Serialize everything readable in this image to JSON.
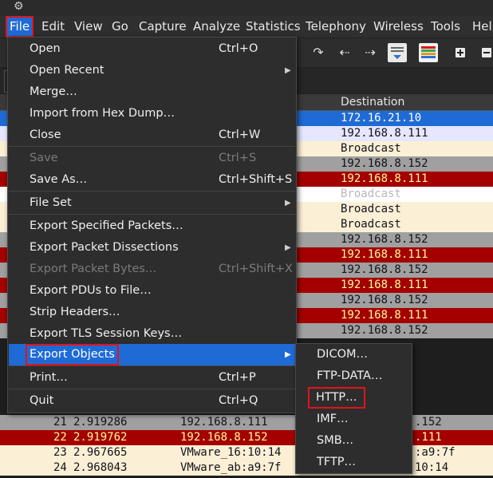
{
  "colors": {
    "selected": "#1f6bd6",
    "highlight_outline": "#e0141b",
    "row_red": "#a40000",
    "row_red_text": "#fffc9c",
    "row_grey": "#a0a0a0",
    "row_cream": "#fbf0d6",
    "row_white": "#ffffff",
    "row_lavender": "#e7e6ff"
  },
  "menubar": {
    "items": [
      {
        "label": "File",
        "key": "file"
      },
      {
        "label": "Edit",
        "key": "edit"
      },
      {
        "label": "View",
        "key": "view"
      },
      {
        "label": "Go",
        "key": "go"
      },
      {
        "label": "Capture",
        "key": "capture"
      },
      {
        "label": "Analyze",
        "key": "analyze"
      },
      {
        "label": "Statistics",
        "key": "statistics"
      },
      {
        "label": "Telephony",
        "key": "telephony"
      },
      {
        "label": "Wireless",
        "key": "wireless"
      },
      {
        "label": "Tools",
        "key": "tools"
      },
      {
        "label": "Help",
        "key": "help"
      }
    ]
  },
  "toolbar": {
    "icons": [
      "go-to-packet-icon",
      "go-back-icon",
      "go-forward-icon",
      "autoscroll-icon",
      "colorize-icon",
      "zoom-in-icon",
      "zoom-out-icon"
    ]
  },
  "packet_list": {
    "header": {
      "destination": "Destination"
    },
    "rows_upper": [
      {
        "dest": "172.16.21.10",
        "style": "selected"
      },
      {
        "dest": "192.168.8.111",
        "style": "lavender"
      },
      {
        "dest": "Broadcast",
        "style": "cream"
      },
      {
        "dest": "192.168.8.152",
        "style": "grey"
      },
      {
        "dest": "192.168.8.111",
        "style": "red"
      },
      {
        "dest": "Broadcast",
        "style": "white"
      },
      {
        "dest": "Broadcast",
        "style": "cream"
      },
      {
        "dest": "Broadcast",
        "style": "cream"
      },
      {
        "dest": "192.168.8.152",
        "style": "grey"
      },
      {
        "dest": "192.168.8.111",
        "style": "red"
      },
      {
        "dest": "192.168.8.152",
        "style": "grey"
      },
      {
        "dest": "192.168.8.111",
        "style": "red"
      },
      {
        "dest": "192.168.8.152",
        "style": "grey"
      },
      {
        "dest": "192.168.8.111",
        "style": "red"
      },
      {
        "dest": "192.168.8.152",
        "style": "grey"
      }
    ],
    "rows_lower": [
      {
        "no": "21",
        "time": "2.919286",
        "source": "192.168.8.111",
        "dest": ".152",
        "style": "grey"
      },
      {
        "no": "22",
        "time": "2.919762",
        "source": "192.168.8.152",
        "dest": ".111",
        "style": "red"
      },
      {
        "no": "23",
        "time": "2.967665",
        "source": "VMware_16:10:14",
        "dest": ":a9:7f",
        "style": "cream"
      },
      {
        "no": "24",
        "time": "2.968043",
        "source": "VMware_ab:a9:7f",
        "dest": "10:14",
        "style": "cream"
      }
    ]
  },
  "file_menu": {
    "items": [
      {
        "label": "Open",
        "shortcut": "Ctrl+O"
      },
      {
        "label": "Open Recent",
        "shortcut": "",
        "submenu": true
      },
      {
        "label": "Merge…",
        "shortcut": ""
      },
      {
        "label": "Import from Hex Dump…",
        "shortcut": ""
      },
      {
        "label": "Close",
        "shortcut": "Ctrl+W"
      },
      {
        "label": "Save",
        "shortcut": "Ctrl+S",
        "disabled": true
      },
      {
        "label": "Save As…",
        "shortcut": "Ctrl+Shift+S"
      },
      {
        "label": "File Set",
        "shortcut": "",
        "submenu": true
      },
      {
        "label": "Export Specified Packets…",
        "shortcut": ""
      },
      {
        "label": "Export Packet Dissections",
        "shortcut": "",
        "submenu": true
      },
      {
        "label": "Export Packet Bytes…",
        "shortcut": "Ctrl+Shift+X",
        "disabled": true
      },
      {
        "label": "Export PDUs to File…",
        "shortcut": ""
      },
      {
        "label": "Strip Headers…",
        "shortcut": ""
      },
      {
        "label": "Export TLS Session Keys…",
        "shortcut": ""
      },
      {
        "label": "Export Objects",
        "shortcut": "",
        "submenu": true
      },
      {
        "label": "Print…",
        "shortcut": "Ctrl+P"
      },
      {
        "label": "Quit",
        "shortcut": "Ctrl+Q"
      }
    ]
  },
  "export_objects_menu": {
    "items": [
      {
        "label": "DICOM…"
      },
      {
        "label": "FTP-DATA…"
      },
      {
        "label": "HTTP…"
      },
      {
        "label": "IMF…"
      },
      {
        "label": "SMB…"
      },
      {
        "label": "TFTP…"
      }
    ]
  }
}
